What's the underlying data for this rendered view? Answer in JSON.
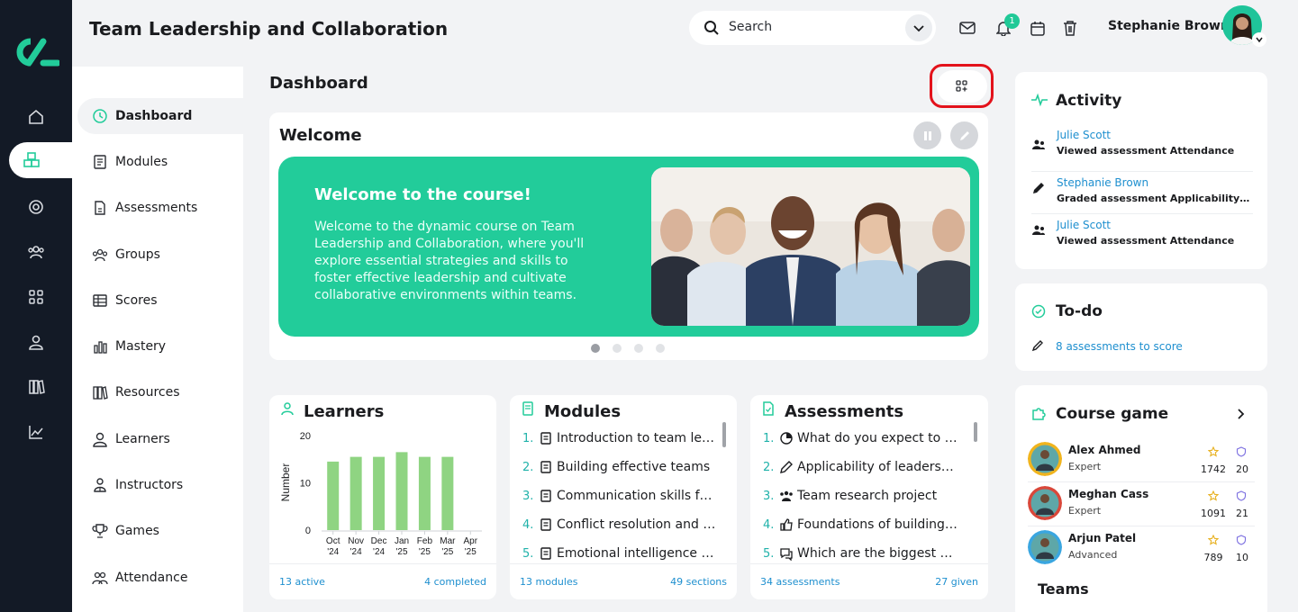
{
  "header": {
    "title": "Team Leadership and Collaboration",
    "search_placeholder": "Search",
    "notification_count": "1",
    "user_name": "Stephanie Brown"
  },
  "sidebar": {
    "items": [
      {
        "label": "Dashboard",
        "icon": "dashboard-icon"
      },
      {
        "label": "Modules",
        "icon": "book-icon"
      },
      {
        "label": "Assessments",
        "icon": "document-icon"
      },
      {
        "label": "Groups",
        "icon": "groups-icon"
      },
      {
        "label": "Scores",
        "icon": "table-icon"
      },
      {
        "label": "Mastery",
        "icon": "bars-icon"
      },
      {
        "label": "Resources",
        "icon": "library-icon"
      },
      {
        "label": "Learners",
        "icon": "user-icon"
      },
      {
        "label": "Instructors",
        "icon": "instructor-icon"
      },
      {
        "label": "Games",
        "icon": "trophy-icon"
      },
      {
        "label": "Attendance",
        "icon": "attendance-icon"
      }
    ]
  },
  "main": {
    "title": "Dashboard",
    "welcome": {
      "title": "Welcome",
      "banner_heading": "Welcome to the course!",
      "banner_text": "Welcome to the dynamic course on Team Leadership and Collaboration, where you'll explore essential strategies and skills to foster effective leadership and cultivate collaborative environments within teams.",
      "active_slide": 1,
      "slide_count": 4
    },
    "learners": {
      "title": "Learners",
      "footer_left": "13 active",
      "footer_right": "4 completed"
    },
    "modules": {
      "title": "Modules",
      "items": [
        {
          "num": "1.",
          "text": "Introduction to team lea..."
        },
        {
          "num": "2.",
          "text": "Building effective teams"
        },
        {
          "num": "3.",
          "text": "Communication skills fo..."
        },
        {
          "num": "4.",
          "text": "Conflict resolution and n..."
        },
        {
          "num": "5.",
          "text": "Emotional intelligence in..."
        }
      ],
      "footer_left": "13 modules",
      "footer_right": "49 sections"
    },
    "assessments": {
      "title": "Assessments",
      "items": [
        {
          "num": "1.",
          "text": "What do you expect to le..."
        },
        {
          "num": "2.",
          "text": "Applicability of leadershi..."
        },
        {
          "num": "3.",
          "text": "Team research project"
        },
        {
          "num": "4.",
          "text": "Foundations of building ..."
        },
        {
          "num": "5.",
          "text": "Which are the biggest a..."
        }
      ],
      "footer_left": "34 assessments",
      "footer_right": "27 given"
    }
  },
  "chart_data": {
    "type": "bar",
    "categories": [
      "Oct '24",
      "Nov '24",
      "Dec '24",
      "Jan '25",
      "Feb '25",
      "Mar '25",
      "Apr '25"
    ],
    "values": [
      14.5,
      15.5,
      15.5,
      16.5,
      15.5,
      15.5,
      null
    ],
    "ylabel": "Number",
    "yticks": [
      "0",
      "10",
      "20"
    ],
    "ylim": [
      0,
      20
    ],
    "grid": false,
    "color": "#8fd482"
  },
  "activity": {
    "title": "Activity",
    "items": [
      {
        "name": "Julie Scott",
        "desc": "Viewed assessment Attendance"
      },
      {
        "name": "Stephanie Brown",
        "desc": "Graded assessment Applicability of ..."
      },
      {
        "name": "Julie Scott",
        "desc": "Viewed assessment Attendance"
      }
    ]
  },
  "todo": {
    "title": "To-do",
    "link": "8 assessments to score"
  },
  "course_game": {
    "title": "Course game",
    "players": [
      {
        "name": "Alex Ahmed",
        "level": "Expert",
        "score": "1742",
        "badges": "20",
        "ring": "#f0b41e"
      },
      {
        "name": "Meghan Cass",
        "level": "Expert",
        "score": "1091",
        "badges": "21",
        "ring": "#d9473a"
      },
      {
        "name": "Arjun Patel",
        "level": "Advanced",
        "score": "789",
        "badges": "10",
        "ring": "#3aa6e0"
      }
    ],
    "teams_title": "Teams"
  },
  "colors": {
    "accent": "#22cc9a",
    "rail": "#131a26",
    "link": "#1e8fcf",
    "highlight": "#e3121b"
  }
}
